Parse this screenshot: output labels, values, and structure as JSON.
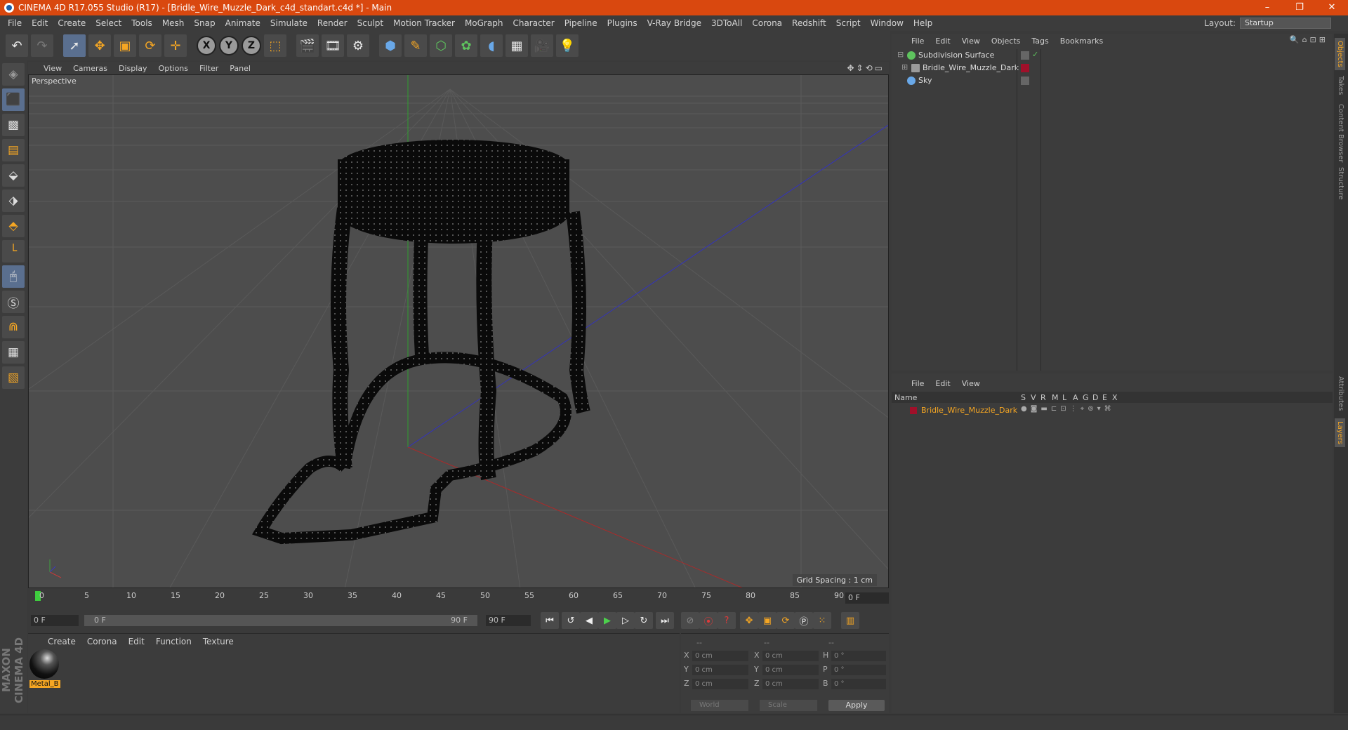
{
  "window": {
    "title": "CINEMA 4D R17.055 Studio (R17) - [Bridle_Wire_Muzzle_Dark_c4d_standart.c4d *] - Main",
    "controls": [
      "–",
      "❐",
      "✕"
    ]
  },
  "menubar": {
    "items": [
      "File",
      "Edit",
      "Create",
      "Select",
      "Tools",
      "Mesh",
      "Snap",
      "Animate",
      "Simulate",
      "Render",
      "Sculpt",
      "Motion Tracker",
      "MoGraph",
      "Character",
      "Pipeline",
      "Plugins",
      "V-Ray Bridge",
      "3DToAll",
      "Corona",
      "Redshift",
      "Script",
      "Window",
      "Help"
    ],
    "layout_label": "Layout:",
    "layout_value": "Startup"
  },
  "viewport": {
    "menu": [
      "View",
      "Cameras",
      "Display",
      "Options",
      "Filter",
      "Panel"
    ],
    "label": "Perspective",
    "grid_spacing": "Grid Spacing : 1 cm"
  },
  "timeline": {
    "ticks": [
      "0",
      "5",
      "10",
      "15",
      "20",
      "25",
      "30",
      "35",
      "40",
      "45",
      "50",
      "55",
      "60",
      "65",
      "70",
      "75",
      "80",
      "85",
      "90"
    ],
    "current_frame": "0 F"
  },
  "playback": {
    "start_field": "0 F",
    "range_start": "0 F",
    "range_end": "90 F",
    "end_field": "90 F"
  },
  "materials": {
    "menu": [
      "Create",
      "Corona",
      "Edit",
      "Function",
      "Texture"
    ],
    "items": [
      {
        "name": "Metal_B"
      }
    ]
  },
  "coordinates": {
    "headers": [
      "--",
      "--",
      "--"
    ],
    "rows": [
      {
        "a_label": "X",
        "a_value": "0 cm",
        "b_label": "X",
        "b_value": "0 cm",
        "c_label": "H",
        "c_value": "0 °"
      },
      {
        "a_label": "Y",
        "a_value": "0 cm",
        "b_label": "Y",
        "b_value": "0 cm",
        "c_label": "P",
        "c_value": "0 °"
      },
      {
        "a_label": "Z",
        "a_value": "0 cm",
        "b_label": "Z",
        "b_value": "0 cm",
        "c_label": "B",
        "c_value": "0 °"
      }
    ],
    "mode1": "World",
    "mode2": "Scale",
    "apply": "Apply"
  },
  "objects": {
    "menu": [
      "File",
      "Edit",
      "View",
      "Objects",
      "Tags",
      "Bookmarks"
    ],
    "items": [
      {
        "name": "Subdivision Surface",
        "color": "#5ec35e"
      },
      {
        "name": "Bridle_Wire_Muzzle_Dark",
        "color": "#9b9b9b"
      },
      {
        "name": "Sky",
        "color": "#69a8e8"
      }
    ]
  },
  "layers": {
    "menu": [
      "File",
      "Edit",
      "View"
    ],
    "columns": [
      "Name",
      "S",
      "V",
      "R",
      "M",
      "L",
      "A",
      "G",
      "D",
      "E",
      "X"
    ],
    "items": [
      {
        "name": "Bridle_Wire_Muzzle_Dark",
        "color": "#a0102a"
      }
    ]
  },
  "right_tabs": [
    "Objects",
    "Takes",
    "Content Browser",
    "Structure",
    "Attributes",
    "Layers"
  ],
  "maxon": "MAXON CINEMA 4D"
}
